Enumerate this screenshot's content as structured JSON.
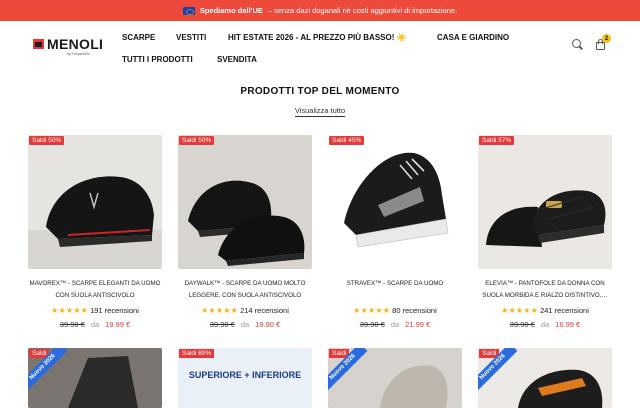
{
  "announcement": {
    "bold": "Spediamo dall'UE",
    "text": "– senza dazi doganali né costi aggiuntivi di importazione."
  },
  "logo": {
    "word": "MENOLI",
    "sub": "by FrequenZio"
  },
  "nav": [
    "SCARPE",
    "VESTITI",
    "HIT ESTATE 2026 - AL PREZZO PIÙ BASSO! ☀️",
    "CASA E GIARDINO",
    "TUTTI I PRODOTTI",
    "SVENDITA"
  ],
  "cart_count": "2",
  "section": {
    "title": "PRODOTTI TOP DEL MOMENTO",
    "view_all": "Visualizza tutto"
  },
  "products": [
    {
      "sale": "Saldi 50%",
      "name": "MAVOREX™ - SCARPE ELEGANTI DA UOMO CON SUOLA ANTISCIVOLO",
      "reviews": "191 recensioni",
      "old": "39.90 €",
      "da": "da",
      "new": "19.99 €"
    },
    {
      "sale": "Saldi 50%",
      "name": "DAYWALK™ - SCARPE DA UOMO MOLTO LEGGERE, CON SUOLA ANTISCIVOLO",
      "reviews": "214 recensioni",
      "old": "39.90 €",
      "da": "da",
      "new": "19.90 €"
    },
    {
      "sale": "Saldi 45%",
      "name": "STRAVEX™ - SCARPE DA UOMO",
      "reviews": "80 recensioni",
      "old": "39.90 €",
      "da": "da",
      "new": "21.99 €"
    },
    {
      "sale": "Saldi 57%",
      "name": "ELEVIA™ - PANTOFOLE DA DONNA CON SUOLA MORBIDA E RIALZO DISTINTIVO,…",
      "reviews": "241 recensioni",
      "old": "39.90 €",
      "da": "da",
      "new": "16.99 €"
    }
  ],
  "row2": [
    {
      "ribbon": "Nuovo 2026",
      "sale": "Saldi"
    },
    {
      "sale": "Saldi 69%",
      "banner": "SUPERIORE + INFERIORE"
    },
    {
      "ribbon": "Nuovo 2026",
      "sale": "Saldi"
    },
    {
      "ribbon": "Nuovo 2026",
      "sale": "Saldi"
    }
  ],
  "colors": {
    "accent": "#e53a3a",
    "announce_bg": "#ee4a3c",
    "star": "#f2b40b",
    "ribbon": "#2a6be0"
  }
}
